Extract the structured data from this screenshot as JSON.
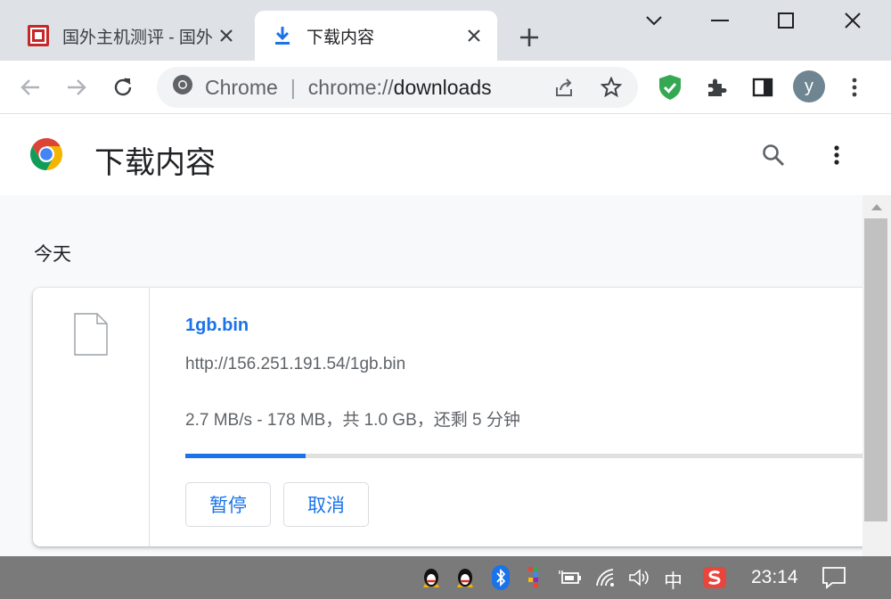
{
  "tabs": [
    {
      "title": "国外主机测评 - 国外",
      "active": false
    },
    {
      "title": "下载内容",
      "active": true
    }
  ],
  "omnibox": {
    "chip": "Chrome",
    "url_scheme": "chrome://",
    "url_host": "downloads"
  },
  "profile": {
    "initial": "y"
  },
  "page": {
    "title": "下载内容"
  },
  "section": {
    "date": "今天"
  },
  "download": {
    "file_name": "1gb.bin",
    "url": "http://156.251.191.54/1gb.bin",
    "status": "2.7 MB/s - 178 MB，共 1.0 GB，还剩 5 分钟",
    "progress_fraction": 0.178,
    "pause_label": "暂停",
    "cancel_label": "取消"
  },
  "taskbar": {
    "ime": "中",
    "time": "23:14"
  },
  "colors": {
    "accent": "#1a73e8",
    "tabstrip": "#dee1e6",
    "taskbar": "#7a7a7a"
  }
}
